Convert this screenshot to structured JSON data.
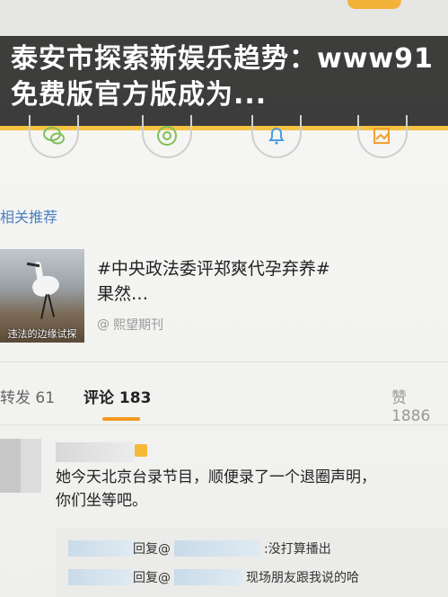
{
  "headline": "泰安市探索新娱乐趋势：www91免费版官方版成为...",
  "related": {
    "title": "相关推荐",
    "thumb_caption": "违法的边缘试探",
    "text": "#中央政法委评郑爽代孕弃养#\n果然…",
    "text_line1": "#中央政法委评郑爽代孕弃养#",
    "text_line2": "果然…",
    "source": "熙望期刊"
  },
  "tabs": [
    {
      "label": "转发 61"
    },
    {
      "label": "评论 183"
    },
    {
      "label": "赞 1886"
    }
  ],
  "comment": {
    "text_line1": "她今天北京台录节目，顺便录了一个退圈声明，",
    "text_line2": "你们坐等吧。",
    "replies": [
      {
        "prefix": "回复@",
        "suffix": ":没打算播出"
      },
      {
        "prefix": "回复@",
        "suffix": "现场朋友跟我说的哈"
      }
    ]
  },
  "colors": {
    "accent": "#f5c242",
    "link": "#4a7fc1",
    "tab_underline": "#f29c1f"
  },
  "icons": [
    "wechat-icon",
    "moments-icon",
    "bell-icon",
    "image-share-icon"
  ]
}
